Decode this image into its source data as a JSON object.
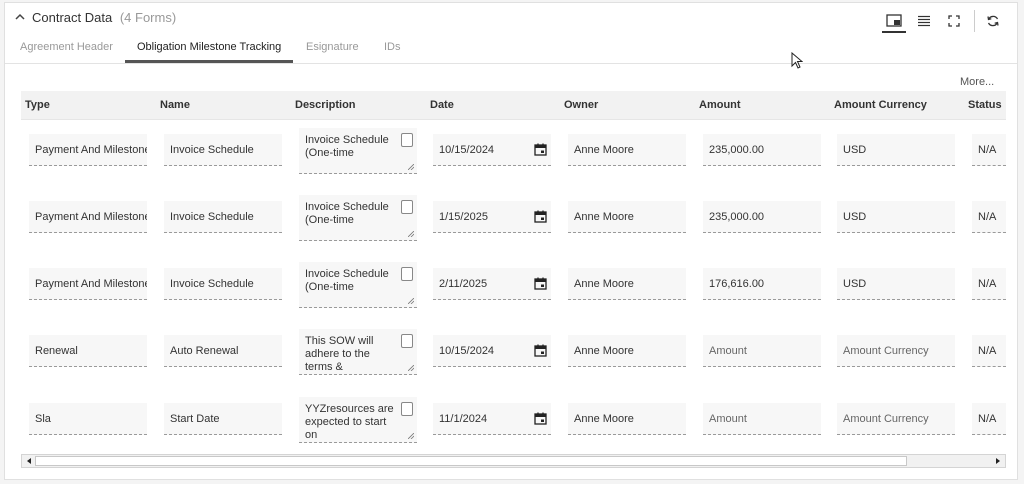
{
  "panel": {
    "title": "Contract Data",
    "form_count": "(4 Forms)"
  },
  "toolbar": {
    "icons": [
      "window-icon",
      "list-icon",
      "expand-icon",
      "refresh-icon"
    ]
  },
  "tabs": [
    {
      "label": "Agreement Header",
      "active": false
    },
    {
      "label": "Obligation Milestone Tracking",
      "active": true
    },
    {
      "label": "Esignature",
      "active": false
    },
    {
      "label": "IDs",
      "active": false
    }
  ],
  "more_label": "More...",
  "columns": [
    "Type",
    "Name",
    "Description",
    "Date",
    "Owner",
    "Amount",
    "Amount Currency",
    "Status"
  ],
  "rows": [
    {
      "type": "Payment And Milestone Schedule",
      "name": "Invoice Schedule",
      "description": "Invoice Schedule (One-time",
      "date": "10/15/2024",
      "owner": "Anne Moore",
      "amount": "235,000.00",
      "currency": "USD",
      "status": "N/A"
    },
    {
      "type": "Payment And Milestone Schedule",
      "name": "Invoice Schedule",
      "description": "Invoice Schedule (One-time",
      "date": "1/15/2025",
      "owner": "Anne Moore",
      "amount": "235,000.00",
      "currency": "USD",
      "status": "N/A"
    },
    {
      "type": "Payment And Milestone Schedule",
      "name": "Invoice Schedule",
      "description": "Invoice Schedule (One-time",
      "date": "2/11/2025",
      "owner": "Anne Moore",
      "amount": "176,616.00",
      "currency": "USD",
      "status": "N/A"
    },
    {
      "type": "Renewal",
      "name": "Auto Renewal",
      "description": "This SOW will adhere to the terms &",
      "date": "10/15/2024",
      "owner": "Anne Moore",
      "amount": "Amount",
      "currency": "Amount Currency",
      "status": "N/A"
    },
    {
      "type": "Sla",
      "name": "Start Date",
      "description": "YYZresources are expected to start on",
      "date": "11/1/2024",
      "owner": "Anne Moore",
      "amount": "Amount",
      "currency": "Amount Currency",
      "status": "N/A"
    }
  ]
}
